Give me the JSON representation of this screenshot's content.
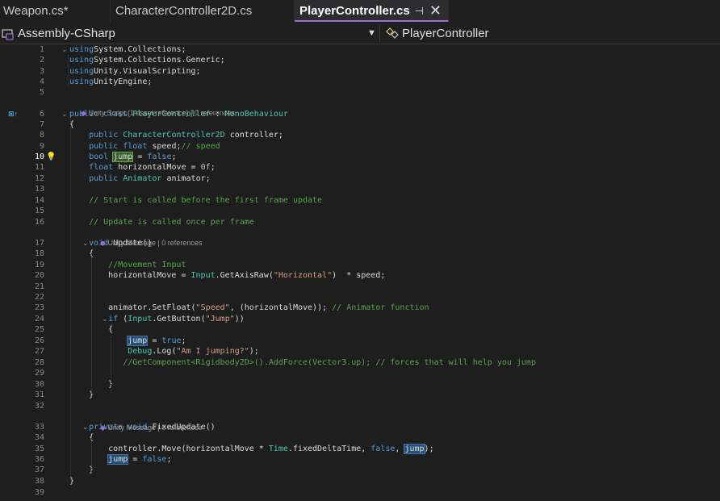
{
  "tabs": [
    {
      "label": "Weapon.cs*"
    },
    {
      "label": "CharacterController2D.cs"
    },
    {
      "label": "PlayerController.cs",
      "pin": "⊣",
      "close": "✕"
    }
  ],
  "nav": {
    "project": "Assembly-CSharp",
    "member": "PlayerController"
  },
  "editor": {
    "current_line": 10,
    "lens": {
      "class_refs": "Unity Script (1 asset reference) | 0 references",
      "update_refs": "Unity Message | 0 references",
      "fixed_refs": "Unity Message | 0 references"
    },
    "lines": [
      {
        "n": 1,
        "tokens": [
          [
            "kw",
            "using"
          ],
          [
            "",
            "System.Collections;"
          ]
        ]
      },
      {
        "n": 2,
        "tokens": [
          [
            "kw",
            "using"
          ],
          [
            "",
            "System.Collections.Generic;"
          ]
        ]
      },
      {
        "n": 3,
        "tokens": [
          [
            "kw",
            "using"
          ],
          [
            "",
            "Unity.VisualScripting;"
          ]
        ]
      },
      {
        "n": 4,
        "tokens": [
          [
            "kw",
            "using"
          ],
          [
            "",
            "UnityEngine;"
          ]
        ]
      },
      {
        "n": 5,
        "tokens": []
      },
      {
        "n": 6,
        "tokens": [
          [
            "kw",
            "public class "
          ],
          [
            "ty",
            "PlayerController"
          ],
          [
            "",
            " : "
          ],
          [
            "ty",
            "MonoBehaviour"
          ]
        ]
      },
      {
        "n": 7,
        "tokens": [
          [
            "",
            "{"
          ]
        ]
      },
      {
        "n": 8,
        "tokens": [
          [
            "",
            "    "
          ],
          [
            "kw",
            "public "
          ],
          [
            "ty",
            "CharacterController2D"
          ],
          [
            "",
            " controller;"
          ]
        ]
      },
      {
        "n": 9,
        "tokens": [
          [
            "",
            "    "
          ],
          [
            "kw",
            "public float "
          ],
          [
            "",
            "speed;"
          ],
          [
            "cm",
            "// speed"
          ]
        ]
      },
      {
        "n": 10,
        "tokens": [
          [
            "",
            "    "
          ],
          [
            "kw",
            "bool "
          ],
          [
            "hlcur",
            "jump"
          ],
          [
            "",
            " = "
          ],
          [
            "kw",
            "false"
          ],
          [
            "",
            ";"
          ]
        ]
      },
      {
        "n": 11,
        "tokens": [
          [
            "",
            "    "
          ],
          [
            "kw",
            "float "
          ],
          [
            "",
            "horizontalMove = "
          ],
          [
            "nu",
            "0f"
          ],
          [
            "",
            ";"
          ]
        ]
      },
      {
        "n": 12,
        "tokens": [
          [
            "",
            "    "
          ],
          [
            "kw",
            "public "
          ],
          [
            "ty",
            "Animator"
          ],
          [
            "",
            " animator;"
          ]
        ]
      },
      {
        "n": 13,
        "tokens": []
      },
      {
        "n": 14,
        "tokens": [
          [
            "",
            "    "
          ],
          [
            "cm",
            "// Start is called before the first frame update"
          ]
        ]
      },
      {
        "n": 15,
        "tokens": []
      },
      {
        "n": 16,
        "tokens": [
          [
            "",
            "    "
          ],
          [
            "cm",
            "// Update is called once per frame"
          ]
        ]
      },
      {
        "n": 17,
        "tokens": [
          [
            "",
            "    "
          ],
          [
            "kw",
            "void "
          ],
          [
            "",
            "Update()"
          ]
        ]
      },
      {
        "n": 18,
        "tokens": [
          [
            "",
            "    {"
          ]
        ]
      },
      {
        "n": 19,
        "tokens": [
          [
            "",
            "        "
          ],
          [
            "cm",
            "//Movement Input"
          ]
        ]
      },
      {
        "n": 20,
        "tokens": [
          [
            "",
            "        horizontalMove = "
          ],
          [
            "ty",
            "Input"
          ],
          [
            "",
            ".GetAxisRaw("
          ],
          [
            "st",
            "\"Horizontal\""
          ],
          [
            "",
            ")  * speed;"
          ]
        ]
      },
      {
        "n": 21,
        "tokens": []
      },
      {
        "n": 22,
        "tokens": []
      },
      {
        "n": 23,
        "tokens": [
          [
            "",
            "        animator.SetFloat("
          ],
          [
            "st",
            "\"Speed\""
          ],
          [
            "",
            ", (horizontalMove)); "
          ],
          [
            "cm",
            "// Animator function"
          ]
        ]
      },
      {
        "n": 24,
        "tokens": [
          [
            "",
            "        "
          ],
          [
            "kw",
            "if "
          ],
          [
            "",
            "("
          ],
          [
            "ty",
            "Input"
          ],
          [
            "",
            ".GetButton("
          ],
          [
            "st",
            "\"Jump\""
          ],
          [
            "",
            "))"
          ]
        ]
      },
      {
        "n": 25,
        "tokens": [
          [
            "",
            "        {"
          ]
        ]
      },
      {
        "n": 26,
        "tokens": [
          [
            "",
            "            "
          ],
          [
            "hl",
            "jump"
          ],
          [
            "",
            " = "
          ],
          [
            "kw",
            "true"
          ],
          [
            "",
            ";"
          ]
        ]
      },
      {
        "n": 27,
        "tokens": [
          [
            "",
            "            "
          ],
          [
            "ty",
            "Debug"
          ],
          [
            "",
            ".Log("
          ],
          [
            "st",
            "\"Am I jumping?\""
          ],
          [
            "",
            ");"
          ]
        ]
      },
      {
        "n": 28,
        "tokens": [
          [
            "",
            "           "
          ],
          [
            "cm",
            "//GetComponent<Rigidbody2D>().AddForce(Vector3.up); // forces that will help you jump"
          ]
        ]
      },
      {
        "n": 29,
        "tokens": []
      },
      {
        "n": 30,
        "tokens": [
          [
            "",
            "        }"
          ]
        ]
      },
      {
        "n": 31,
        "tokens": [
          [
            "",
            "    }"
          ]
        ]
      },
      {
        "n": 32,
        "tokens": []
      },
      {
        "n": 33,
        "tokens": [
          [
            "",
            "    "
          ],
          [
            "kw",
            "private void "
          ],
          [
            "",
            "FixedUpdate()"
          ]
        ]
      },
      {
        "n": 34,
        "tokens": [
          [
            "",
            "    {"
          ]
        ]
      },
      {
        "n": 35,
        "tokens": [
          [
            "",
            "        controller.Move(horizontalMove * "
          ],
          [
            "ty",
            "Time"
          ],
          [
            "",
            ".fixedDeltaTime, "
          ],
          [
            "kw",
            "false"
          ],
          [
            "",
            ", "
          ],
          [
            "hl",
            "jump"
          ],
          [
            "",
            ");"
          ]
        ]
      },
      {
        "n": 36,
        "tokens": [
          [
            "",
            "        "
          ],
          [
            "hl",
            "jump"
          ],
          [
            "",
            " = "
          ],
          [
            "kw",
            "false"
          ],
          [
            "",
            ";"
          ]
        ]
      },
      {
        "n": 37,
        "tokens": [
          [
            "",
            "    }"
          ]
        ]
      },
      {
        "n": 38,
        "tokens": [
          [
            "",
            "}"
          ]
        ]
      },
      {
        "n": 39,
        "tokens": []
      }
    ]
  }
}
